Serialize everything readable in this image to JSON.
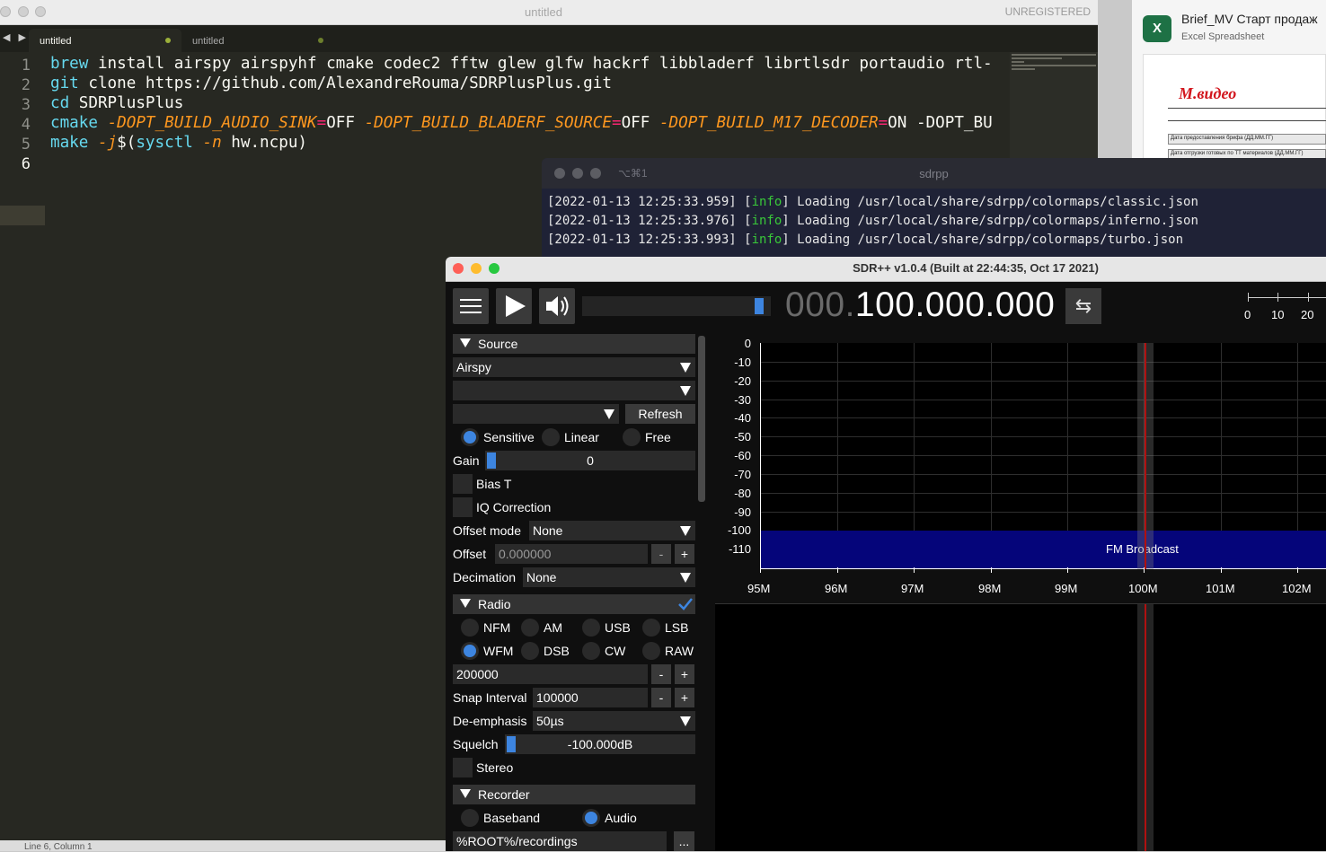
{
  "editor": {
    "title": "untitled",
    "unregistered": "UNREGISTERED",
    "tabs": [
      {
        "label": "untitled"
      },
      {
        "label": "untitled"
      }
    ],
    "nav": "◀ ▶",
    "line_numbers": [
      "1",
      "2",
      "3",
      "4",
      "5",
      "6"
    ],
    "lines": [
      "brew install airspy airspyhf cmake codec2 fftw glew glfw hackrf libbladerf librtlsdr portaudio rtl-",
      "git clone https://github.com/AlexandreRouma/SDRPlusPlus.git",
      "cd SDRPlusPlus",
      "cmake -DOPT_BUILD_AUDIO_SINK=OFF -DOPT_BUILD_BLADERF_SOURCE=OFF -DOPT_BUILD_M17_DECODER=ON -DOPT_BU",
      "make -j$(sysctl -n hw.ncpu)"
    ],
    "status": "Line 6, Column 1"
  },
  "excel": {
    "name": "Brief_MV Старт продаж",
    "kind": "Excel Spreadsheet",
    "icon": "X",
    "logo": "М.видео",
    "rows": [
      "Дата предоставления брифа (ДД.ММ.ГГ)",
      "Дата отгрузки готовых по ТТ материалов (ДД.ММ.ГГ)"
    ]
  },
  "terminal": {
    "shortcut": "⌥⌘1",
    "title": "sdrpp",
    "lines": [
      {
        "ts": "[2022-01-13 12:25:33.959]",
        "lvl": "info",
        "msg": "Loading /usr/local/share/sdrpp/colormaps/classic.json"
      },
      {
        "ts": "[2022-01-13 12:25:33.976]",
        "lvl": "info",
        "msg": "Loading /usr/local/share/sdrpp/colormaps/inferno.json"
      },
      {
        "ts": "[2022-01-13 12:25:33.993]",
        "lvl": "info",
        "msg": "Loading /usr/local/share/sdrpp/colormaps/turbo.json"
      }
    ]
  },
  "sdr": {
    "title": "SDR++ v1.0.4 (Built at 22:44:35, Oct 17 2021)",
    "volume": 0.97,
    "freq_dim": "000.",
    "freq_main": "100.000.000",
    "swap_icon": "⇆",
    "scale": [
      "0",
      "10",
      "20"
    ],
    "source": {
      "header": "Source",
      "device": "Airspy",
      "refresh": "Refresh",
      "modes": [
        "Sensitive",
        "Linear",
        "Free"
      ],
      "mode_selected": "Sensitive",
      "gain_label": "Gain",
      "gain_value": "0",
      "bias_t": "Bias T",
      "iq_correction": "IQ Correction",
      "offset_mode_label": "Offset mode",
      "offset_mode": "None",
      "offset_label": "Offset",
      "offset_value": "0.000000",
      "minus": "-",
      "plus": "+",
      "decimation_label": "Decimation",
      "decimation": "None"
    },
    "radio": {
      "header": "Radio",
      "modes_row1": [
        "NFM",
        "AM",
        "USB",
        "LSB"
      ],
      "modes_row2": [
        "WFM",
        "DSB",
        "CW",
        "RAW"
      ],
      "mode_selected": "WFM",
      "bandwidth": "200000",
      "snap_label": "Snap Interval",
      "snap_value": "100000",
      "deemph_label": "De-emphasis",
      "deemph_value": "50µs",
      "squelch_label": "Squelch",
      "squelch_value": "-100.000dB",
      "stereo": "Stereo"
    },
    "recorder": {
      "header": "Recorder",
      "modes": [
        "Baseband",
        "Audio"
      ],
      "mode_selected": "Audio",
      "path": "%ROOT%/recordings",
      "browse": "..."
    },
    "fft": {
      "db_labels": [
        "0",
        "-10",
        "-20",
        "-30",
        "-40",
        "-50",
        "-60",
        "-70",
        "-80",
        "-90",
        "-100",
        "-110"
      ],
      "freq_labels": [
        "95M",
        "96M",
        "97M",
        "98M",
        "99M",
        "100M",
        "101M",
        "102M"
      ],
      "band_label": "FM Broadcast"
    }
  }
}
